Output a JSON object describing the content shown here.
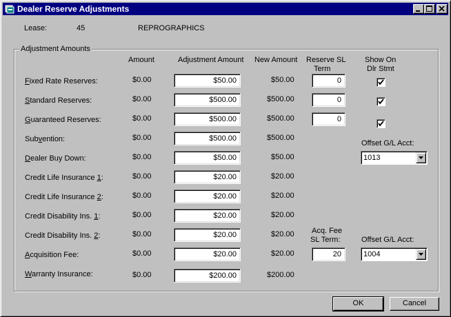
{
  "window": {
    "title": "Dealer Reserve Adjustments"
  },
  "lease": {
    "label": "Lease:",
    "number": "45",
    "name": "REPROGRAPHICS"
  },
  "group": {
    "title": "Adjustment Amounts"
  },
  "headers": {
    "amount": "Amount",
    "adjustment": "Adjustment Amount",
    "new_amount": "New Amount",
    "reserve_sl_line1": "Reserve SL",
    "reserve_sl_line2": "Term",
    "show_on_line1": "Show On",
    "show_on_line2": "Dlr Stmt"
  },
  "rows": [
    {
      "label_pre": "",
      "label_key": "F",
      "label_post": "ixed Rate Reserves:",
      "amount": "$0.00",
      "adjustment": "$50.00",
      "new_amount": "$50.00",
      "term": "0",
      "show": true
    },
    {
      "label_pre": "",
      "label_key": "S",
      "label_post": "tandard Reserves:",
      "amount": "$0.00",
      "adjustment": "$500.00",
      "new_amount": "$500.00",
      "term": "0",
      "show": true
    },
    {
      "label_pre": "",
      "label_key": "G",
      "label_post": "uaranteed Reserves:",
      "amount": "$0.00",
      "adjustment": "$500.00",
      "new_amount": "$500.00",
      "term": "0",
      "show": true
    },
    {
      "label_pre": "Sub",
      "label_key": "v",
      "label_post": "ention:",
      "amount": "$0.00",
      "adjustment": "$500.00",
      "new_amount": "$500.00"
    },
    {
      "label_pre": "",
      "label_key": "D",
      "label_post": "ealer Buy Down:",
      "amount": "$0.00",
      "adjustment": "$50.00",
      "new_amount": "$50.00"
    },
    {
      "label_pre": "Credit Life Insurance ",
      "label_key": "1",
      "label_post": ":",
      "amount": "$0.00",
      "adjustment": "$20.00",
      "new_amount": "$20.00"
    },
    {
      "label_pre": "Credit Life Insurance ",
      "label_key": "2",
      "label_post": ":",
      "amount": "$0.00",
      "adjustment": "$20.00",
      "new_amount": "$20.00"
    },
    {
      "label_pre": "Credit Disability Ins. ",
      "label_key": "1",
      "label_post": ":",
      "amount": "$0.00",
      "adjustment": "$20.00",
      "new_amount": "$20.00"
    },
    {
      "label_pre": "Credit Disability Ins. ",
      "label_key": "2",
      "label_post": ":",
      "amount": "$0.00",
      "adjustment": "$20.00",
      "new_amount": "$20.00"
    },
    {
      "label_pre": "",
      "label_key": "A",
      "label_post": "cquisition Fee:",
      "amount": "$0.00",
      "adjustment": "$20.00",
      "new_amount": "$20.00"
    },
    {
      "label_pre": "",
      "label_key": "W",
      "label_post": "arranty Insurance:",
      "amount": "$0.00",
      "adjustment": "$200.00",
      "new_amount": "$200.00"
    }
  ],
  "offset_gl_1": {
    "label": "Offset G/L Acct:",
    "value": "1013"
  },
  "acq_fee": {
    "label_line1": "Acq. Fee",
    "label_line2": "SL Term:",
    "term": "20"
  },
  "offset_gl_2": {
    "label": "Offset G/L Acct:",
    "value": "1004"
  },
  "buttons": {
    "ok": "OK",
    "cancel": "Cancel"
  },
  "colors": {
    "titlebar": "#000080",
    "face": "#c0c0c0"
  }
}
